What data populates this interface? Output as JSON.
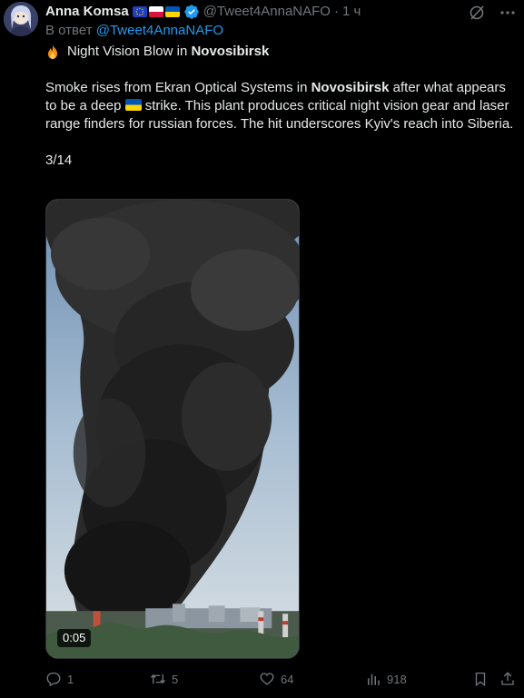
{
  "author": {
    "name": "Anna Komsa",
    "handle": "@Tweet4AnnaNAFO",
    "separator": "·",
    "time": "1 ч",
    "flags": [
      "eu-flag",
      "poland-flag",
      "ukraine-flag"
    ]
  },
  "reply": {
    "prefix": "В ответ ",
    "handle": "@Tweet4AnnaNAFO"
  },
  "post": {
    "title_prefix": "Night Vision Blow in ",
    "title_bold": "Novosibirsk",
    "body_part1": "Smoke rises from Ekran Optical Systems in ",
    "body_bold": "Novosibirsk",
    "body_part2": " after what appears to be a deep ",
    "body_part3": " strike. This plant produces critical night vision gear and laser range finders for russian forces. The hit underscores Kyiv's reach into Siberia.",
    "counter": "3/14"
  },
  "media": {
    "duration": "0:05"
  },
  "actions": {
    "replies": "1",
    "retweets": "5",
    "likes": "64",
    "views": "918"
  },
  "colors": {
    "background": "#000000",
    "text": "#e7e9ea",
    "muted": "#71767b",
    "link": "#1d9bf0",
    "verified": "#1d9bf0"
  },
  "icons": {
    "top_right": [
      "grok-icon",
      "more-icon"
    ],
    "actions": [
      "reply-icon",
      "retweet-icon",
      "like-icon",
      "views-icon",
      "bookmark-icon",
      "share-icon"
    ]
  }
}
